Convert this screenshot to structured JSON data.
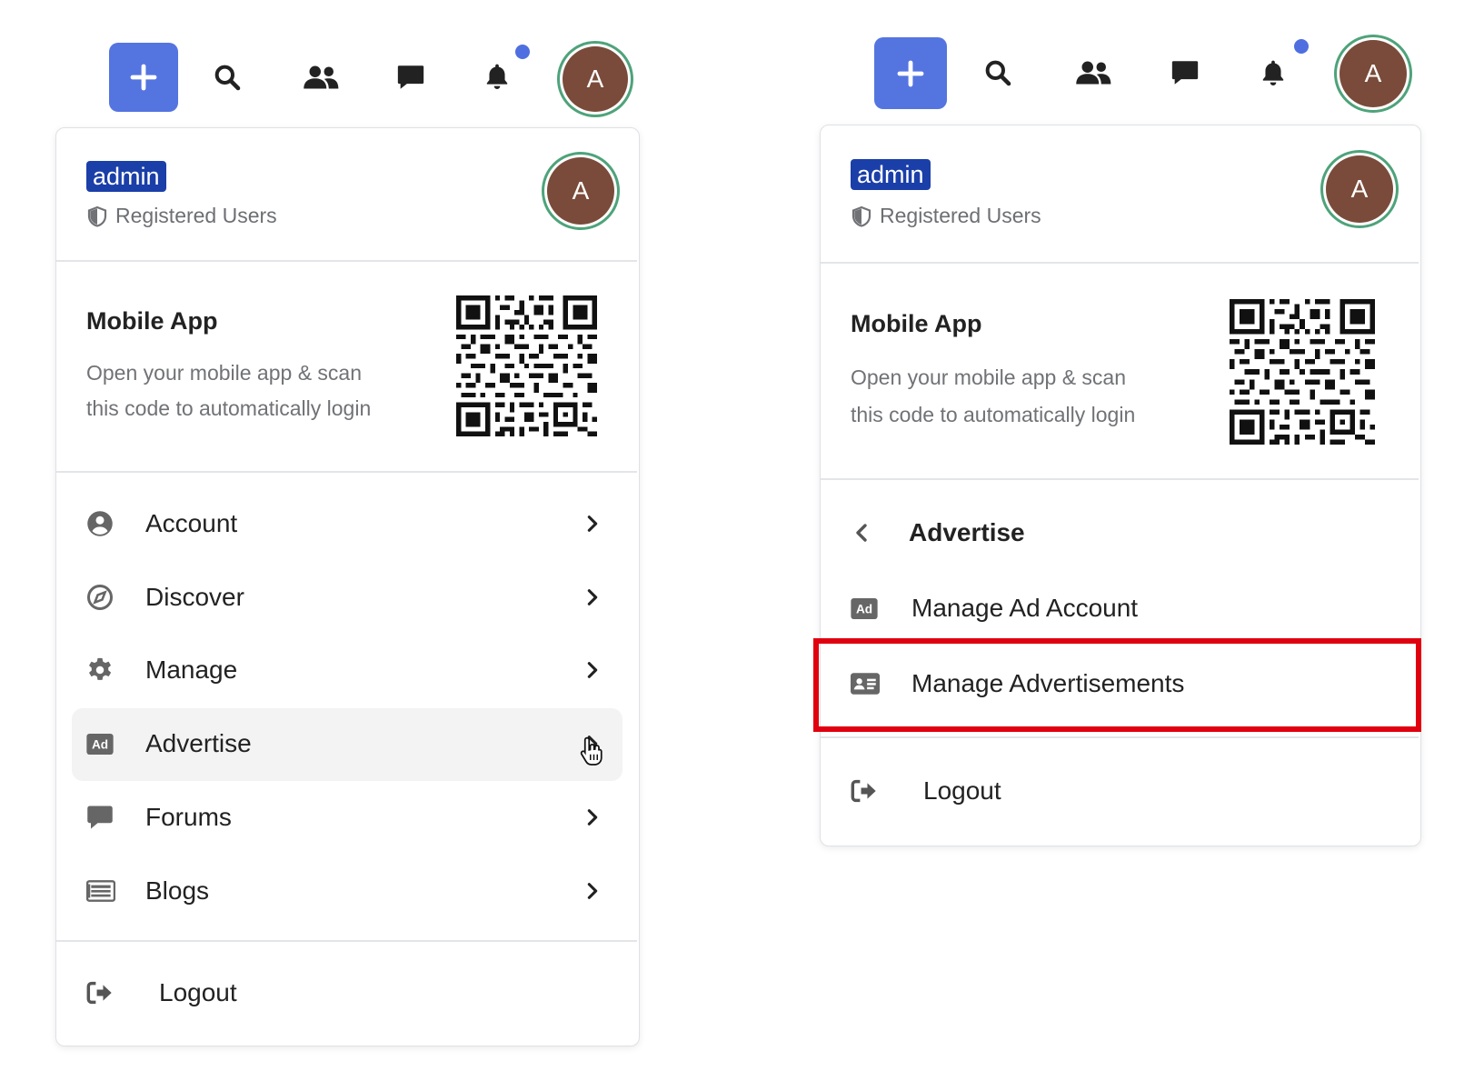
{
  "colors": {
    "accent": "#5475e0",
    "badge": "#1b3fa8",
    "avatar": "#7a4b3a",
    "avatar_ring": "#4ea37a",
    "highlight": "#e0000f"
  },
  "left": {
    "topbar": {
      "avatar_letter": "A"
    },
    "user": {
      "badge": "admin",
      "role": "Registered Users",
      "avatar_letter": "A"
    },
    "mobile": {
      "title": "Mobile App",
      "line1": "Open your mobile app & scan",
      "line2": "this code to automatically login"
    },
    "menu": [
      {
        "label": "Account",
        "icon": "user-circle-icon"
      },
      {
        "label": "Discover",
        "icon": "compass-icon"
      },
      {
        "label": "Manage",
        "icon": "gear-icon"
      },
      {
        "label": "Advertise",
        "icon": "ad-icon"
      },
      {
        "label": "Forums",
        "icon": "comment-icon"
      },
      {
        "label": "Blogs",
        "icon": "newspaper-icon"
      }
    ],
    "logout": "Logout"
  },
  "right": {
    "topbar": {
      "avatar_letter": "A"
    },
    "user": {
      "badge": "admin",
      "role": "Registered Users",
      "avatar_letter": "A"
    },
    "mobile": {
      "title": "Mobile App",
      "line1": "Open your mobile app & scan",
      "line2": "this code to automatically login"
    },
    "submenu": {
      "back_label": "Advertise",
      "items": [
        {
          "label": "Manage Ad Account",
          "icon": "ad-icon"
        },
        {
          "label": "Manage Advertisements",
          "icon": "id-card-icon"
        }
      ]
    },
    "logout": "Logout"
  }
}
